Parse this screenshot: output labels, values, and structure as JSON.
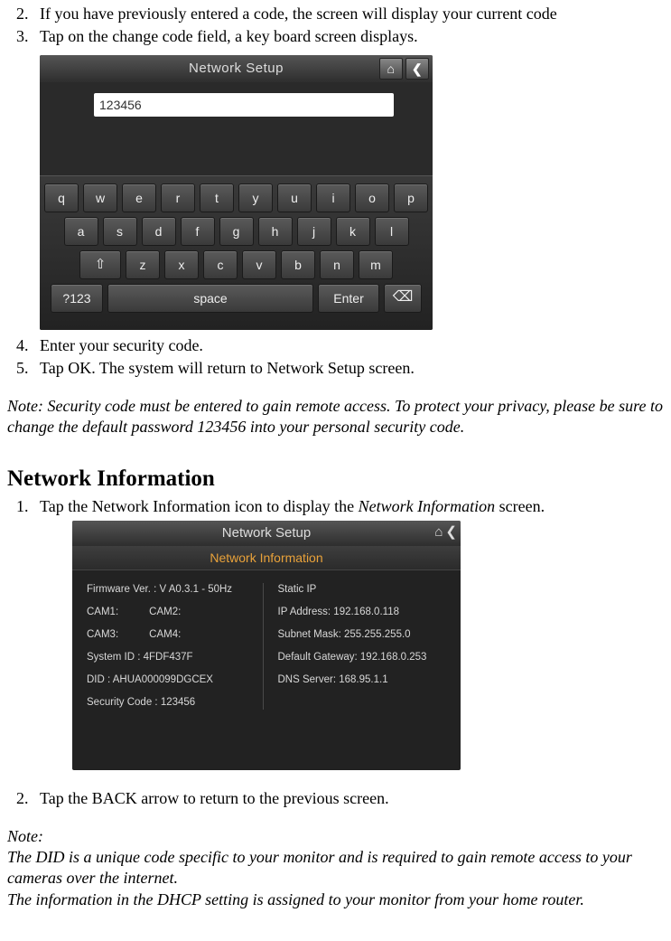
{
  "steps_a": {
    "s2": "If you have previously entered a code, the screen will display your current code",
    "s3": "Tap on the change code field, a key board screen displays."
  },
  "kb_screen": {
    "title": "Network Setup",
    "home_icon": "⌂",
    "back_icon": "❮",
    "code_value": "123456",
    "row1": {
      "q": "q",
      "w": "w",
      "e": "e",
      "r": "r",
      "t": "t",
      "y": "y",
      "u": "u",
      "i": "i",
      "o": "o",
      "p": "p"
    },
    "row2": {
      "a": "a",
      "s": "s",
      "d": "d",
      "f": "f",
      "g": "g",
      "h": "h",
      "j": "j",
      "k": "k",
      "l": "l"
    },
    "row3": {
      "shift": "⇧",
      "z": "z",
      "x": "x",
      "c": "c",
      "v": "v",
      "b": "b",
      "n": "n",
      "m": "m"
    },
    "row4": {
      "nums": "?123",
      "space": "space",
      "enter": "Enter",
      "del": "⌫"
    }
  },
  "steps_b": {
    "s4": "Enter your security code.",
    "s5": "Tap OK. The system will return to Network Setup screen."
  },
  "note1": "Note: Security code must be entered to gain remote access. To protect your privacy, please be sure to change the default password 123456 into your personal security code.",
  "section_heading": "Network Information",
  "steps_c": {
    "s1_pre": "Tap the Network Information icon to display the ",
    "s1_em": "Network Information",
    "s1_post": " screen."
  },
  "ni_screen": {
    "title": "Network Setup",
    "subtitle": "Network Information",
    "home_icon": "⌂",
    "back_icon": "❮",
    "left": {
      "fw": "Firmware Ver. : V A0.3.1 - 50Hz",
      "cam1": "CAM1:",
      "cam2": "CAM2:",
      "cam3": "CAM3:",
      "cam4": "CAM4:",
      "sysid": "System ID : 4FDF437F",
      "did": "DID : AHUA000099DGCEX",
      "sec": "Security Code : 123456"
    },
    "right": {
      "mode": "Static IP",
      "ip": "IP Address: 192.168.0.118",
      "mask": "Subnet Mask: 255.255.255.0",
      "gw": "Default Gateway: 192.168.0.253",
      "dns": "DNS Server: 168.95.1.1"
    }
  },
  "steps_d": {
    "s2": "Tap the BACK arrow to return to the previous screen."
  },
  "note2_label": "Note:",
  "note2_line1": "The DID is a unique code specific to your monitor and is required to gain remote access to your cameras over the internet.",
  "note2_line2": "The information in the DHCP setting is assigned to your monitor from your home router."
}
